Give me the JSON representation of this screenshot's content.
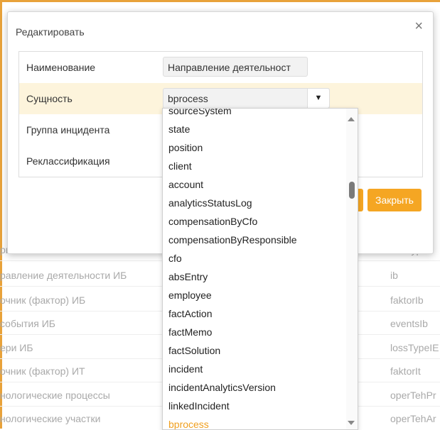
{
  "background_table": {
    "rows": [
      {
        "name": "риска",
        "code": "riskType"
      },
      {
        "name": "равление деятельности ИБ",
        "code": "ib"
      },
      {
        "name": "очник (фактор) ИБ",
        "code": "faktorIb"
      },
      {
        "name": "события ИБ",
        "code": "eventsIb"
      },
      {
        "name": "ери ИБ",
        "code": "lossTypeIE"
      },
      {
        "name": "очник (фактор) ИТ",
        "code": "faktorIt"
      },
      {
        "name": "нологические процессы",
        "code": "operTehPr"
      },
      {
        "name": "нологические участки",
        "code": "operTehAr"
      }
    ]
  },
  "modal": {
    "title": "Редактировать",
    "close_icon": "×",
    "rows": [
      {
        "label": "Наименование",
        "value": "Направление деятельност"
      },
      {
        "label": "Сущность",
        "value": "bprocess"
      },
      {
        "label": "Группа инцидента"
      },
      {
        "label": "Реклассификация"
      }
    ],
    "close_button": "Закрыть",
    "select_arrow": "▼"
  },
  "dropdown": {
    "items": [
      "sourceSystem",
      "state",
      "position",
      "client",
      "account",
      "analyticsStatusLog",
      "compensationByCfo",
      "compensationByResponsible",
      "cfo",
      "absEntry",
      "employee",
      "factAction",
      "factMemo",
      "factSolution",
      "incident",
      "incidentAnalyticsVersion",
      "linkedIncident",
      "bprocess"
    ],
    "selected": "bprocess"
  },
  "colors": {
    "accent": "#f5a623",
    "highlight_row": "#fdf4dc"
  }
}
